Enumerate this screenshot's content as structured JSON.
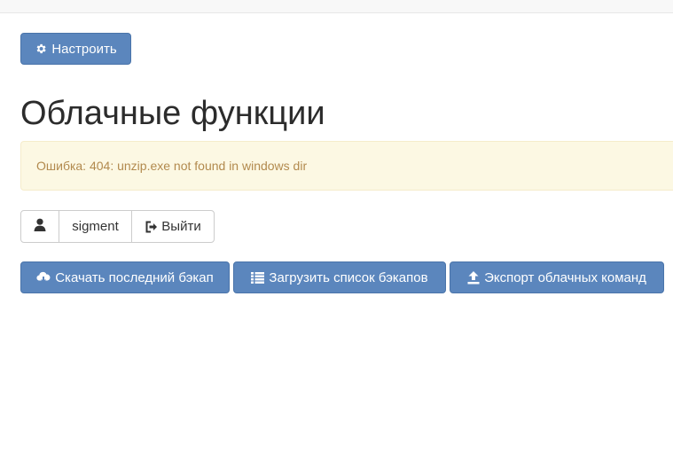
{
  "toolbar": {
    "configure_label": "Настроить",
    "configure_icon": "gear-icon"
  },
  "page": {
    "title": "Облачные функции"
  },
  "alert": {
    "message": "Ошибка: 404: unzip.exe not found in windows dir"
  },
  "user": {
    "icon": "user-icon",
    "username": "sigment",
    "logout_label": "Выйти",
    "logout_icon": "sign-out-icon"
  },
  "actions": {
    "download_label": "Скачать последний бэкап",
    "download_icon": "cloud-download-icon",
    "list_label": "Загрузить список бэкапов",
    "list_icon": "list-icon",
    "export_label": "Экспорт облачных команд",
    "export_icon": "upload-icon"
  },
  "colors": {
    "primary": "#5b86bd",
    "alert_bg": "#fcf8e3",
    "alert_text": "#b28a4e"
  }
}
